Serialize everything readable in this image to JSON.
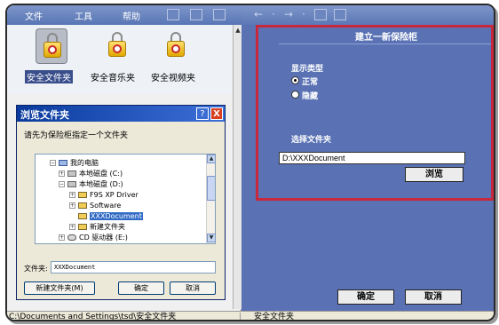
{
  "menubar": {
    "file": "文件",
    "tools": "工具",
    "help": "帮助"
  },
  "vaults": [
    {
      "label": "安全文件夹",
      "icon": "vault-lock-icon",
      "selected": true
    },
    {
      "label": "安全音乐夹",
      "icon": "vault-lock-icon",
      "selected": false
    },
    {
      "label": "安全视频夹",
      "icon": "vault-lock-icon",
      "selected": false
    }
  ],
  "dialog": {
    "title": "浏览文件夹",
    "help": "?",
    "close": "X",
    "prompt": "请先为保险柜指定一个文件夹",
    "tree": [
      {
        "label": "我的电脑",
        "expander": "−",
        "icon": "computer-icon",
        "selected": false
      },
      {
        "label": "本地磁盘 (C:)",
        "expander": "+",
        "icon": "disk-icon",
        "selected": false
      },
      {
        "label": "本地磁盘 (D:)",
        "expander": "−",
        "icon": "disk-icon",
        "selected": false
      },
      {
        "label": "F9S XP Driver",
        "expander": "+",
        "icon": "folder-icon",
        "selected": false
      },
      {
        "label": "Software",
        "expander": "+",
        "icon": "folder-icon",
        "selected": false
      },
      {
        "label": "XXXDocument",
        "expander": "",
        "icon": "folder-icon",
        "selected": true
      },
      {
        "label": "新建文件夹",
        "expander": "+",
        "icon": "folder-icon",
        "selected": false
      },
      {
        "label": "CD 驱动器 (E:)",
        "expander": "+",
        "icon": "cd-drive-icon",
        "selected": false
      }
    ],
    "folder_label": "文件夹:",
    "folder_value": "XXXDocument",
    "new_folder": "新建文件夹(M)",
    "ok": "确定",
    "cancel": "取消"
  },
  "panel": {
    "title": "建立一新保险柜",
    "display_type_label": "显示类型",
    "radio_normal": "正常",
    "radio_hidden": "隐藏",
    "selected_radio": "normal",
    "choose_folder_label": "选择文件夹",
    "path_value": "D:\\XXXDocument",
    "browse": "浏览"
  },
  "footer_buttons": {
    "ok": "确定",
    "cancel": "取消"
  },
  "status": {
    "path": "C:\\Documents and Settings\\tsd\\安全文件夹",
    "current": "安全文件夹"
  },
  "colors": {
    "accent_red": "#c8283c",
    "pane_blue": "#5a72b4",
    "title_blue": "#0a3a9c"
  }
}
